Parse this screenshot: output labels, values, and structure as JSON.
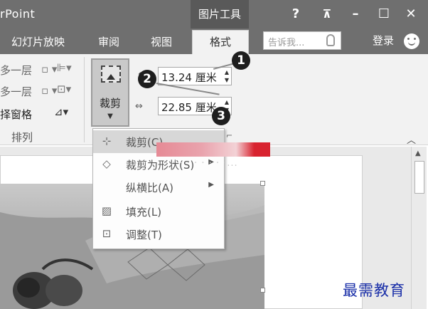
{
  "titlebar": {
    "app_title": "rPoint",
    "picture_tools": "图片工具",
    "help": "?",
    "ribbon_display": "⊼",
    "minimize": "–",
    "maximize": "☐",
    "close": "✕"
  },
  "tabs": {
    "slideshow": "幻灯片放映",
    "review": "审阅",
    "view": "视图",
    "format": "格式",
    "tell_me": "告诉我...",
    "login": "登录"
  },
  "ribbon": {
    "arrange": {
      "bring_forward": "多一层",
      "send_backward": "多一层",
      "selection_pane": "择窗格",
      "group_label": "排列"
    },
    "crop_label": "裁剪",
    "height_value": "13.24 厘米",
    "width_value": "22.85 厘米",
    "callouts": [
      "1",
      "2",
      "3"
    ]
  },
  "crop_menu": {
    "items": [
      {
        "label": "裁剪(C)",
        "icon": "crop-icon"
      },
      {
        "label": "裁剪为形状(S)",
        "icon": "crop-to-shape-icon"
      },
      {
        "label": "纵横比(A)",
        "icon": ""
      },
      {
        "label": "填充(L)",
        "icon": "fill-icon"
      },
      {
        "label": "调整(T)",
        "icon": "fit-icon"
      }
    ],
    "blurred_hint": "·  ·  ·  ·  ·  ·  ·  ·  ·..."
  },
  "watermark": "最需教育",
  "colors": {
    "titlebar": "#6f6f6f",
    "ribbon": "#f2f2f2",
    "watermark": "#1a2fa8",
    "callout": "#1e1e1e"
  }
}
